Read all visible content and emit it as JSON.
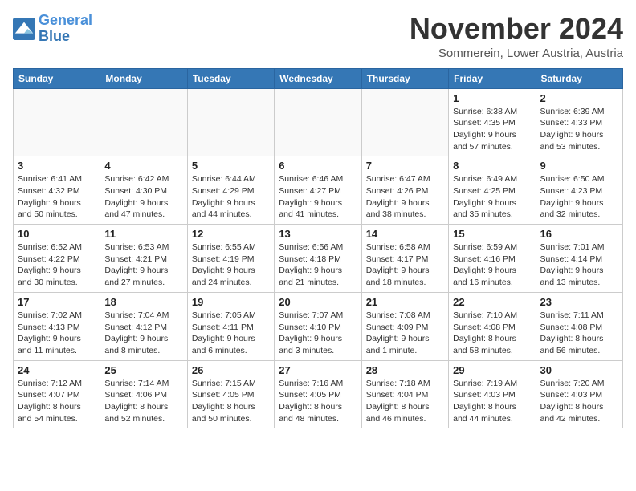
{
  "header": {
    "logo_line1": "General",
    "logo_line2": "Blue",
    "month": "November 2024",
    "location": "Sommerein, Lower Austria, Austria"
  },
  "weekdays": [
    "Sunday",
    "Monday",
    "Tuesday",
    "Wednesday",
    "Thursday",
    "Friday",
    "Saturday"
  ],
  "weeks": [
    [
      {
        "day": "",
        "info": ""
      },
      {
        "day": "",
        "info": ""
      },
      {
        "day": "",
        "info": ""
      },
      {
        "day": "",
        "info": ""
      },
      {
        "day": "",
        "info": ""
      },
      {
        "day": "1",
        "info": "Sunrise: 6:38 AM\nSunset: 4:35 PM\nDaylight: 9 hours\nand 57 minutes."
      },
      {
        "day": "2",
        "info": "Sunrise: 6:39 AM\nSunset: 4:33 PM\nDaylight: 9 hours\nand 53 minutes."
      }
    ],
    [
      {
        "day": "3",
        "info": "Sunrise: 6:41 AM\nSunset: 4:32 PM\nDaylight: 9 hours\nand 50 minutes."
      },
      {
        "day": "4",
        "info": "Sunrise: 6:42 AM\nSunset: 4:30 PM\nDaylight: 9 hours\nand 47 minutes."
      },
      {
        "day": "5",
        "info": "Sunrise: 6:44 AM\nSunset: 4:29 PM\nDaylight: 9 hours\nand 44 minutes."
      },
      {
        "day": "6",
        "info": "Sunrise: 6:46 AM\nSunset: 4:27 PM\nDaylight: 9 hours\nand 41 minutes."
      },
      {
        "day": "7",
        "info": "Sunrise: 6:47 AM\nSunset: 4:26 PM\nDaylight: 9 hours\nand 38 minutes."
      },
      {
        "day": "8",
        "info": "Sunrise: 6:49 AM\nSunset: 4:25 PM\nDaylight: 9 hours\nand 35 minutes."
      },
      {
        "day": "9",
        "info": "Sunrise: 6:50 AM\nSunset: 4:23 PM\nDaylight: 9 hours\nand 32 minutes."
      }
    ],
    [
      {
        "day": "10",
        "info": "Sunrise: 6:52 AM\nSunset: 4:22 PM\nDaylight: 9 hours\nand 30 minutes."
      },
      {
        "day": "11",
        "info": "Sunrise: 6:53 AM\nSunset: 4:21 PM\nDaylight: 9 hours\nand 27 minutes."
      },
      {
        "day": "12",
        "info": "Sunrise: 6:55 AM\nSunset: 4:19 PM\nDaylight: 9 hours\nand 24 minutes."
      },
      {
        "day": "13",
        "info": "Sunrise: 6:56 AM\nSunset: 4:18 PM\nDaylight: 9 hours\nand 21 minutes."
      },
      {
        "day": "14",
        "info": "Sunrise: 6:58 AM\nSunset: 4:17 PM\nDaylight: 9 hours\nand 18 minutes."
      },
      {
        "day": "15",
        "info": "Sunrise: 6:59 AM\nSunset: 4:16 PM\nDaylight: 9 hours\nand 16 minutes."
      },
      {
        "day": "16",
        "info": "Sunrise: 7:01 AM\nSunset: 4:14 PM\nDaylight: 9 hours\nand 13 minutes."
      }
    ],
    [
      {
        "day": "17",
        "info": "Sunrise: 7:02 AM\nSunset: 4:13 PM\nDaylight: 9 hours\nand 11 minutes."
      },
      {
        "day": "18",
        "info": "Sunrise: 7:04 AM\nSunset: 4:12 PM\nDaylight: 9 hours\nand 8 minutes."
      },
      {
        "day": "19",
        "info": "Sunrise: 7:05 AM\nSunset: 4:11 PM\nDaylight: 9 hours\nand 6 minutes."
      },
      {
        "day": "20",
        "info": "Sunrise: 7:07 AM\nSunset: 4:10 PM\nDaylight: 9 hours\nand 3 minutes."
      },
      {
        "day": "21",
        "info": "Sunrise: 7:08 AM\nSunset: 4:09 PM\nDaylight: 9 hours\nand 1 minute."
      },
      {
        "day": "22",
        "info": "Sunrise: 7:10 AM\nSunset: 4:08 PM\nDaylight: 8 hours\nand 58 minutes."
      },
      {
        "day": "23",
        "info": "Sunrise: 7:11 AM\nSunset: 4:08 PM\nDaylight: 8 hours\nand 56 minutes."
      }
    ],
    [
      {
        "day": "24",
        "info": "Sunrise: 7:12 AM\nSunset: 4:07 PM\nDaylight: 8 hours\nand 54 minutes."
      },
      {
        "day": "25",
        "info": "Sunrise: 7:14 AM\nSunset: 4:06 PM\nDaylight: 8 hours\nand 52 minutes."
      },
      {
        "day": "26",
        "info": "Sunrise: 7:15 AM\nSunset: 4:05 PM\nDaylight: 8 hours\nand 50 minutes."
      },
      {
        "day": "27",
        "info": "Sunrise: 7:16 AM\nSunset: 4:05 PM\nDaylight: 8 hours\nand 48 minutes."
      },
      {
        "day": "28",
        "info": "Sunrise: 7:18 AM\nSunset: 4:04 PM\nDaylight: 8 hours\nand 46 minutes."
      },
      {
        "day": "29",
        "info": "Sunrise: 7:19 AM\nSunset: 4:03 PM\nDaylight: 8 hours\nand 44 minutes."
      },
      {
        "day": "30",
        "info": "Sunrise: 7:20 AM\nSunset: 4:03 PM\nDaylight: 8 hours\nand 42 minutes."
      }
    ]
  ]
}
